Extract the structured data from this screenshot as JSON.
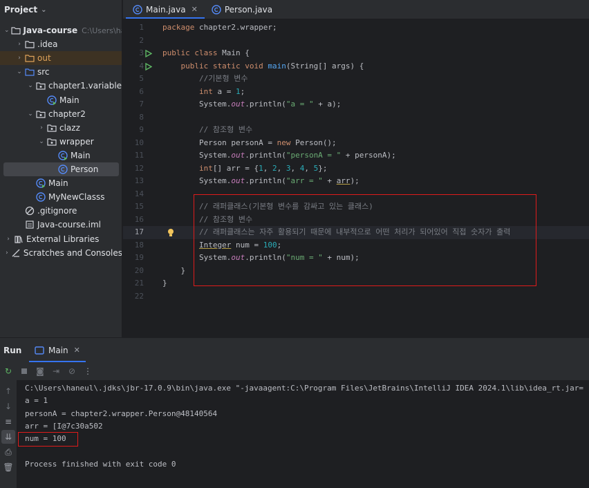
{
  "project": {
    "title": "Project",
    "tree": [
      {
        "name": "Java-course",
        "hint": "C:\\Users\\haneu",
        "type": "module",
        "arrow": "down",
        "bold": true
      },
      {
        "name": ".idea",
        "type": "folder",
        "arrow": "right"
      },
      {
        "name": "out",
        "type": "folder-excluded",
        "arrow": "right"
      },
      {
        "name": "src",
        "type": "folder-src",
        "arrow": "down"
      },
      {
        "name": "chapter1.variable",
        "type": "package",
        "arrow": "down"
      },
      {
        "name": "Main",
        "type": "class-run"
      },
      {
        "name": "chapter2",
        "type": "package",
        "arrow": "down"
      },
      {
        "name": "clazz",
        "type": "package",
        "arrow": "right"
      },
      {
        "name": "wrapper",
        "type": "package",
        "arrow": "down"
      },
      {
        "name": "Main",
        "type": "class-run"
      },
      {
        "name": "Person",
        "type": "class",
        "selected": true
      },
      {
        "name": "Main",
        "type": "class-run"
      },
      {
        "name": "MyNewClasss",
        "type": "class"
      },
      {
        "name": ".gitignore",
        "type": "ignore"
      },
      {
        "name": "Java-course.iml",
        "type": "iml"
      },
      {
        "name": "External Libraries",
        "type": "libs",
        "arrow": "right"
      },
      {
        "name": "Scratches and Consoles",
        "type": "scratch",
        "arrow": "right"
      }
    ]
  },
  "editor": {
    "tabs": [
      {
        "label": "Main.java",
        "active": true,
        "closable": true
      },
      {
        "label": "Person.java",
        "active": false,
        "closable": false
      }
    ],
    "current_line": 17,
    "lines": [
      [
        {
          "t": "package ",
          "c": "kw"
        },
        {
          "t": "chapter2.wrapper;"
        }
      ],
      [],
      [
        {
          "t": "public class ",
          "c": "kw"
        },
        {
          "t": "Main {"
        }
      ],
      [
        {
          "t": "    public static void ",
          "c": "kw"
        },
        {
          "t": "main",
          "c": "fn"
        },
        {
          "t": "(String[] args) {"
        }
      ],
      [
        {
          "t": "        //기본형 변수",
          "c": "cm"
        }
      ],
      [
        {
          "t": "        "
        },
        {
          "t": "int ",
          "c": "kw"
        },
        {
          "t": "a = "
        },
        {
          "t": "1",
          "c": "num"
        },
        {
          "t": ";"
        }
      ],
      [
        {
          "t": "        System."
        },
        {
          "t": "out",
          "c": "st"
        },
        {
          "t": ".println("
        },
        {
          "t": "\"a = \"",
          "c": "str"
        },
        {
          "t": " + a);"
        }
      ],
      [],
      [
        {
          "t": "        // 참조형 변수",
          "c": "cm"
        }
      ],
      [
        {
          "t": "        Person personA = "
        },
        {
          "t": "new ",
          "c": "kw"
        },
        {
          "t": "Person();"
        }
      ],
      [
        {
          "t": "        System."
        },
        {
          "t": "out",
          "c": "st"
        },
        {
          "t": ".println("
        },
        {
          "t": "\"personA = \"",
          "c": "str"
        },
        {
          "t": " + personA);"
        }
      ],
      [
        {
          "t": "        "
        },
        {
          "t": "int",
          "c": "kw"
        },
        {
          "t": "[] arr = {"
        },
        {
          "t": "1",
          "c": "num"
        },
        {
          "t": ", "
        },
        {
          "t": "2",
          "c": "num"
        },
        {
          "t": ", "
        },
        {
          "t": "3",
          "c": "num"
        },
        {
          "t": ", "
        },
        {
          "t": "4",
          "c": "num"
        },
        {
          "t": ", "
        },
        {
          "t": "5",
          "c": "num"
        },
        {
          "t": "};"
        }
      ],
      [
        {
          "t": "        System."
        },
        {
          "t": "out",
          "c": "st"
        },
        {
          "t": ".println("
        },
        {
          "t": "\"arr = \"",
          "c": "str"
        },
        {
          "t": " + "
        },
        {
          "t": "arr",
          "c": "ul"
        },
        {
          "t": ");"
        }
      ],
      [],
      [
        {
          "t": "        // 래퍼클래스(기본형 변수를 감싸고 있는 클래스)",
          "c": "cm"
        }
      ],
      [
        {
          "t": "        // 참조형 변수",
          "c": "cm"
        }
      ],
      [
        {
          "t": "        // 래퍼클래스는 자주 활용되기 때문에 내부적으로 어떤 처리가 되어있어 직접 숫자가 출력",
          "c": "cm"
        }
      ],
      [
        {
          "t": "        "
        },
        {
          "t": "Integer",
          "c": "ul"
        },
        {
          "t": " num = "
        },
        {
          "t": "100",
          "c": "num"
        },
        {
          "t": ";"
        }
      ],
      [
        {
          "t": "        System."
        },
        {
          "t": "out",
          "c": "st"
        },
        {
          "t": ".println("
        },
        {
          "t": "\"num = \"",
          "c": "str"
        },
        {
          "t": " + num);"
        }
      ],
      [
        {
          "t": "    }"
        }
      ],
      [
        {
          "t": "}"
        }
      ],
      []
    ]
  },
  "run": {
    "title": "Run",
    "tab": "Main",
    "console": [
      "C:\\Users\\haneul\\.jdks\\jbr-17.0.9\\bin\\java.exe \"-javaagent:C:\\Program Files\\JetBrains\\IntelliJ IDEA 2024.1\\lib\\idea_rt.jar=",
      "a = 1",
      "personA = chapter2.wrapper.Person@48140564",
      "arr = [I@7c30a502",
      "num = 100",
      "",
      "Process finished with exit code 0"
    ]
  },
  "colors": {
    "accent": "#3574f0",
    "highlight_box": "#e01b1b",
    "run_icon": "#5fb865"
  }
}
